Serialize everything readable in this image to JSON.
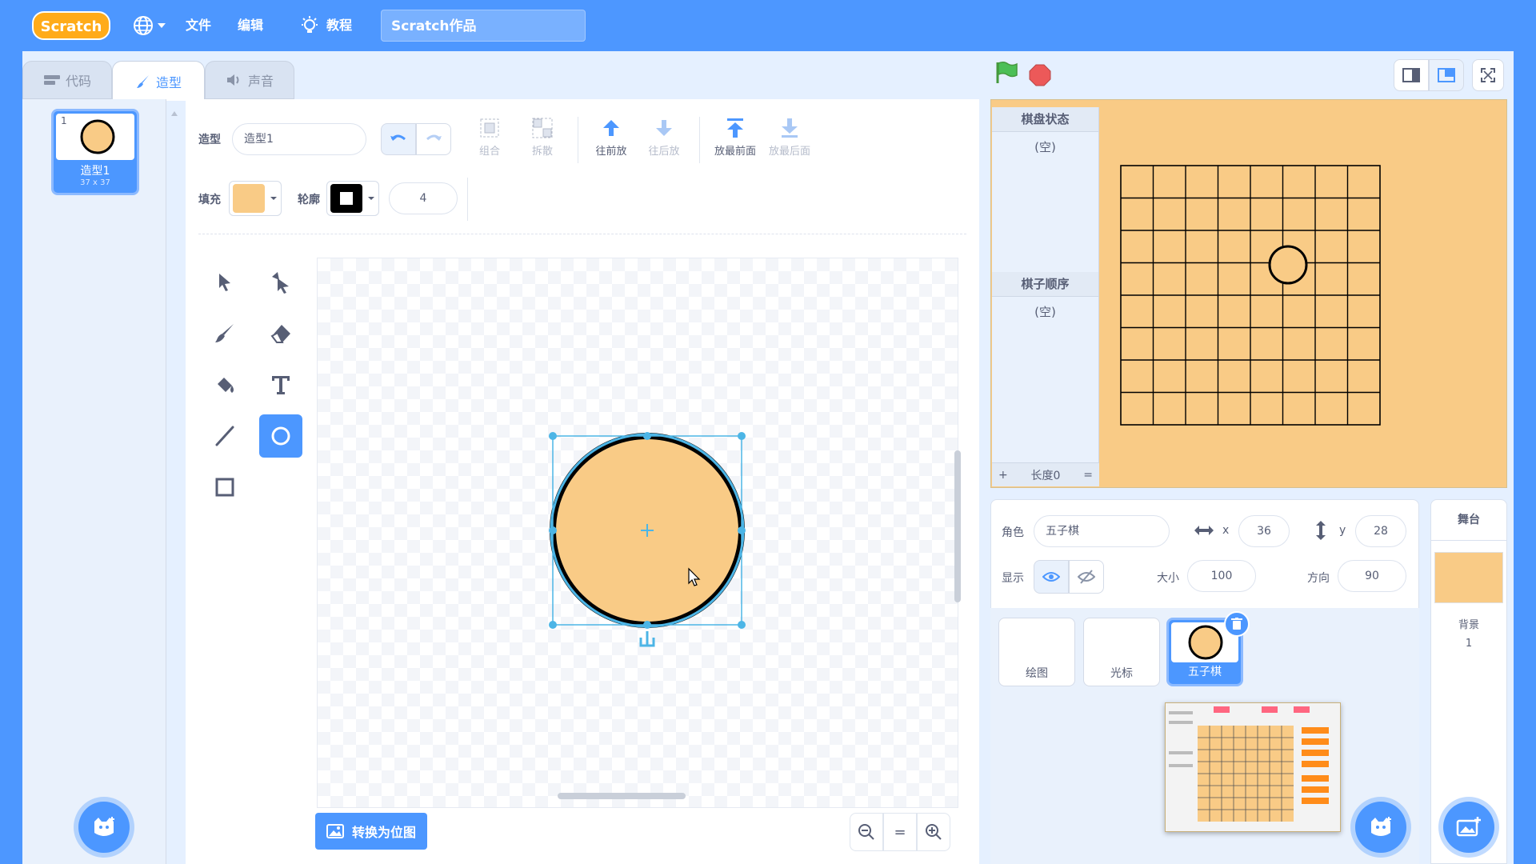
{
  "menubar": {
    "logo_text": "Scratch",
    "language_icon": "globe-icon",
    "file_label": "文件",
    "edit_label": "编辑",
    "tutorials_label": "教程",
    "project_title": "Scratch作品"
  },
  "tabs": {
    "code_label": "代码",
    "costumes_label": "造型",
    "sounds_label": "声音"
  },
  "costume_list": {
    "items": [
      {
        "index": "1",
        "name": "造型1",
        "size": "37 x 37"
      }
    ]
  },
  "paint_editor": {
    "costume_label": "造型",
    "costume_name": "造型1",
    "group_label": "组合",
    "ungroup_label": "拆散",
    "forward_label": "往前放",
    "backward_label": "往后放",
    "front_label": "放最前面",
    "back_label": "放最后面",
    "fill_label": "填充",
    "outline_label": "轮廓",
    "outline_width": "4",
    "fill_color": "#f9cb86",
    "outline_color": "#000000",
    "convert_label": "转换为位图",
    "zoom_equal": "="
  },
  "stage": {
    "monitor_board_title": "棋盘状态",
    "monitor_board_value": "(空)",
    "monitor_order_title": "棋子顺序",
    "monitor_order_value": "(空)",
    "list_add": "+",
    "list_length": "长度0",
    "list_resize": "=",
    "background_color": "#f9cb86"
  },
  "sprite_info": {
    "sprite_label": "角色",
    "sprite_name": "五子棋",
    "x_label": "x",
    "x_value": "36",
    "y_label": "y",
    "y_value": "28",
    "show_label": "显示",
    "size_label": "大小",
    "size_value": "100",
    "direction_label": "方向",
    "direction_value": "90"
  },
  "sprites": [
    {
      "name": "绘图"
    },
    {
      "name": "光标"
    },
    {
      "name": "五子棋"
    }
  ],
  "stage_selector": {
    "title": "舞台",
    "backdrop_label": "背景",
    "backdrop_count": "1"
  },
  "colors": {
    "accent": "#4c97ff",
    "menubar": "#4d97ff",
    "costume_fill": "#f9cb86"
  }
}
